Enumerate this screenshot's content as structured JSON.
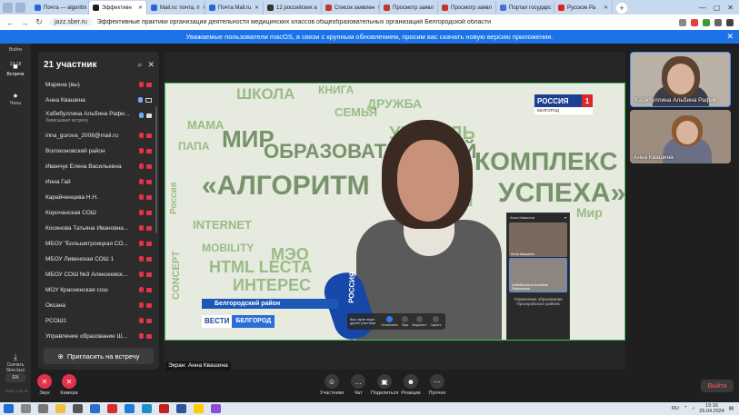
{
  "browser": {
    "tabs": [
      {
        "label": "Почта — algoritm",
        "color": "#2a66d9",
        "active": false
      },
      {
        "label": "Эффективн",
        "color": "#1d1d1d",
        "active": true
      },
      {
        "label": "Mail.ru: почта, п",
        "color": "#2a66d9",
        "active": false
      },
      {
        "label": "Почта Mail.ru",
        "color": "#2a66d9",
        "active": false
      },
      {
        "label": "12 российских а",
        "color": "#333333",
        "active": false
      },
      {
        "label": "Список заявлен",
        "color": "#c0392b",
        "active": false
      },
      {
        "label": "Просмотр заявл",
        "color": "#c0392b",
        "active": false
      },
      {
        "label": "Просмотр заявл",
        "color": "#c0392b",
        "active": false
      },
      {
        "label": "Портал государс",
        "color": "#4a6fd0",
        "active": false
      },
      {
        "label": "Русское Ра",
        "color": "#e02020",
        "active": false
      }
    ],
    "new_tab": "+",
    "url": "jazz.sber.ru",
    "page_title": "Эффективные практики организации деятельности медицинских классов общеобразовательных организаций Белгородской области"
  },
  "banner": {
    "text": "Уважаемые пользователи macOS, в связи с крупным обновлением, просим вас скачать новую версию приложения.",
    "close": "✕"
  },
  "rail": {
    "exit": "Войти",
    "time": "23:18",
    "meetings": "Встречи",
    "chats": "Чаты",
    "download": "Скачать SberJazz",
    "lang": "EN",
    "version": "SBER 2.45.38"
  },
  "participants": {
    "title": "21 участник",
    "invite_label": "Пригласить на встречу",
    "list": [
      {
        "name": "Марина (вы)",
        "state": "muted"
      },
      {
        "name": "Анна Квашина",
        "state": "presenting"
      },
      {
        "name": "Хабибуллина Альбина Рафи...",
        "sub": "Записывает встречу",
        "state": "recording"
      },
      {
        "name": "inna_gurova_2008@mail.ru",
        "state": "muted"
      },
      {
        "name": "Волоконовский район",
        "state": "muted"
      },
      {
        "name": "Иванчук Елена Васильевна",
        "state": "muted"
      },
      {
        "name": "Инна Гай",
        "state": "muted"
      },
      {
        "name": "Карайченцева Н.Н.",
        "state": "muted"
      },
      {
        "name": "Корочанская СОШ",
        "state": "muted"
      },
      {
        "name": "Косинова Татьяна Ивановна...",
        "state": "muted"
      },
      {
        "name": "МБОУ \"Большетроицкая СО...",
        "state": "muted"
      },
      {
        "name": "МБОУ Ливенская СОШ 1",
        "state": "muted"
      },
      {
        "name": "МБОУ СОШ №3 Алексеевск...",
        "state": "muted"
      },
      {
        "name": "МОУ Красненская сош",
        "state": "muted"
      },
      {
        "name": "Оксана",
        "state": "muted"
      },
      {
        "name": "РСОШ1",
        "state": "muted"
      },
      {
        "name": "Управление образование Ш...",
        "state": "muted"
      }
    ]
  },
  "share": {
    "words": [
      "ШКОЛА",
      "КНИГА",
      "СЕМЬЯ",
      "ДРУЖБА",
      "УЧИТЕЛЬ",
      "МАМА",
      "МИР",
      "ПАПА",
      "ОБРАЗОВАТЕЛЬНЫЙ",
      "КОМПЛЕКС",
      "«АЛГОРИТМ",
      "УСПЕХА»",
      "Россия",
      "CONCEPT",
      "INTERNET",
      "МЭО",
      "MOBILITY",
      "HTML LECTA",
      "ИНТЕРЕС",
      "Мир",
      "МЭШ"
    ],
    "channel_logo": "РОССИЯ",
    "channel_number": "1",
    "channel_region": "БЕЛГОРОД",
    "mic_label": "РОССИЯ",
    "lower_third": "Белгородский район",
    "vesti": "ВЕСТИ",
    "vesti_region": "БЕЛГОРОД",
    "mini_toolbar": {
      "note": "Ваш экран видят другие участники",
      "stop": "Остановить",
      "sound": "Звук",
      "highlight": "Выделить",
      "hide": "Скрыть"
    },
    "float_panel": {
      "title": "Анна Квашина",
      "tile1": "Анна Квашина",
      "tile2": "Хабибуллина Альбина Рафиковна",
      "info": "Управление образования Прохоровского района"
    },
    "screen_label": "Экран: Анна Квашина"
  },
  "tiles": [
    {
      "name": "Хабибуллина Альбина Рафик...",
      "selected": true
    },
    {
      "name": "Анна Квашина",
      "selected": false
    }
  ],
  "controls": {
    "sound": "Звук",
    "camera": "Камера",
    "participants": "Участники",
    "chat": "Чат",
    "share": "Поделиться",
    "reactions": "Реакции",
    "more": "Прочее",
    "leave": "Выйти"
  },
  "taskbar": {
    "lang": "RU",
    "time": "15:16",
    "date": "25.04.2024"
  },
  "colors": {
    "accent": "#1a73e8",
    "muted_red": "#e2334a",
    "share_border": "#3fbf5f"
  }
}
